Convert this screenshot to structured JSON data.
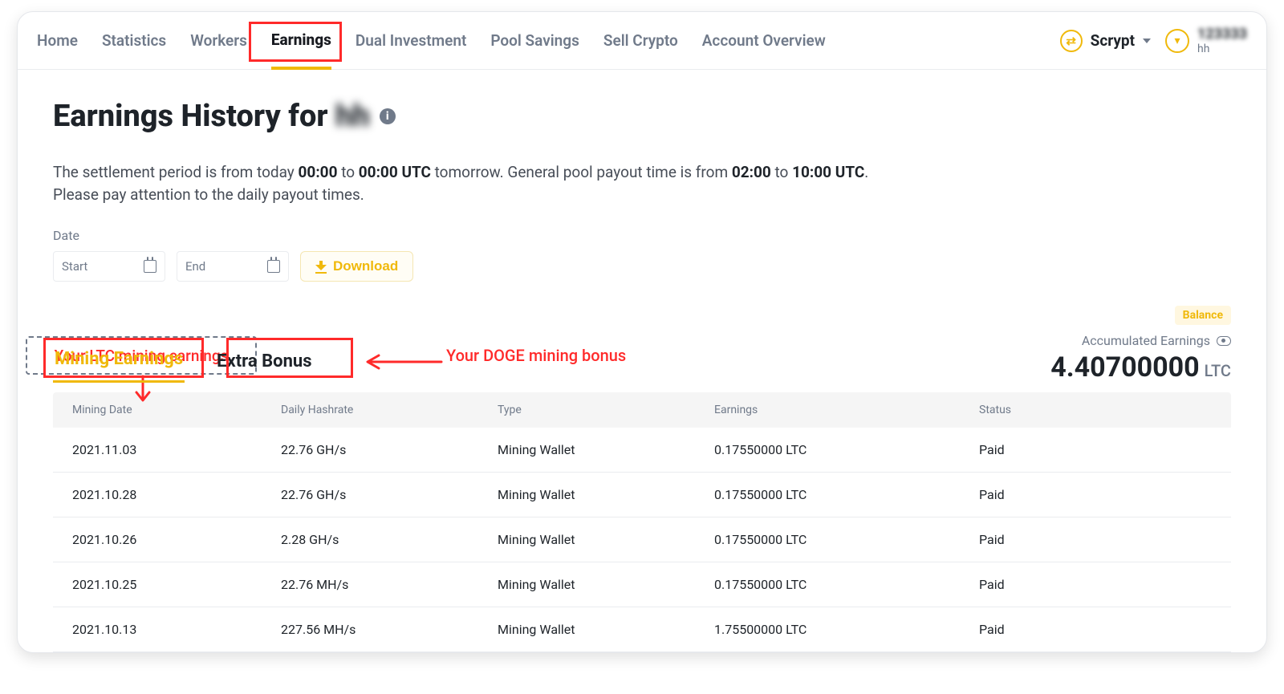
{
  "nav": {
    "items": [
      "Home",
      "Statistics",
      "Workers",
      "Earnings",
      "Dual Investment",
      "Pool Savings",
      "Sell Crypto",
      "Account Overview"
    ],
    "activeIndex": 3,
    "coin": "Scrypt",
    "accountId": "123333",
    "accountSub": "hh"
  },
  "page": {
    "title_prefix": "Earnings History for ",
    "title_masked": "hh",
    "settlement_a": "The settlement period is from today ",
    "t1": "00:00",
    "settlement_b": " to ",
    "t2": "00:00 UTC",
    "settlement_c": " tomorrow. General pool payout time is from ",
    "t3": "02:00",
    "settlement_d": " to ",
    "t4": "10:00 UTC",
    "settlement_e": ".",
    "settlement_line2": "Please pay attention to the daily payout times.",
    "date_label": "Date",
    "start_placeholder": "Start",
    "end_placeholder": "End",
    "download": "Download",
    "anno_ltc": "Your LTC mining earnings",
    "anno_doge": "Your DOGE mining bonus",
    "tab_earnings": "Mining Earnings",
    "tab_bonus": "Extra Bonus",
    "balance": "Balance",
    "acc_label": "Accumulated Earnings",
    "acc_value": "4.40700000",
    "acc_cur": "LTC"
  },
  "table": {
    "headers": [
      "Mining Date",
      "Daily Hashrate",
      "Type",
      "Earnings",
      "Status"
    ],
    "rows": [
      {
        "date": "2021.11.03",
        "hash": "22.76 GH/s",
        "type": "Mining Wallet",
        "earn": "0.17550000 LTC",
        "status": "Paid"
      },
      {
        "date": "2021.10.28",
        "hash": "22.76 GH/s",
        "type": "Mining Wallet",
        "earn": "0.17550000 LTC",
        "status": "Paid"
      },
      {
        "date": "2021.10.26",
        "hash": "2.28 GH/s",
        "type": "Mining Wallet",
        "earn": "0.17550000 LTC",
        "status": "Paid"
      },
      {
        "date": "2021.10.25",
        "hash": "22.76 MH/s",
        "type": "Mining Wallet",
        "earn": "0.17550000 LTC",
        "status": "Paid"
      },
      {
        "date": "2021.10.13",
        "hash": "227.56 MH/s",
        "type": "Mining Wallet",
        "earn": "1.75500000 LTC",
        "status": "Paid"
      }
    ]
  }
}
